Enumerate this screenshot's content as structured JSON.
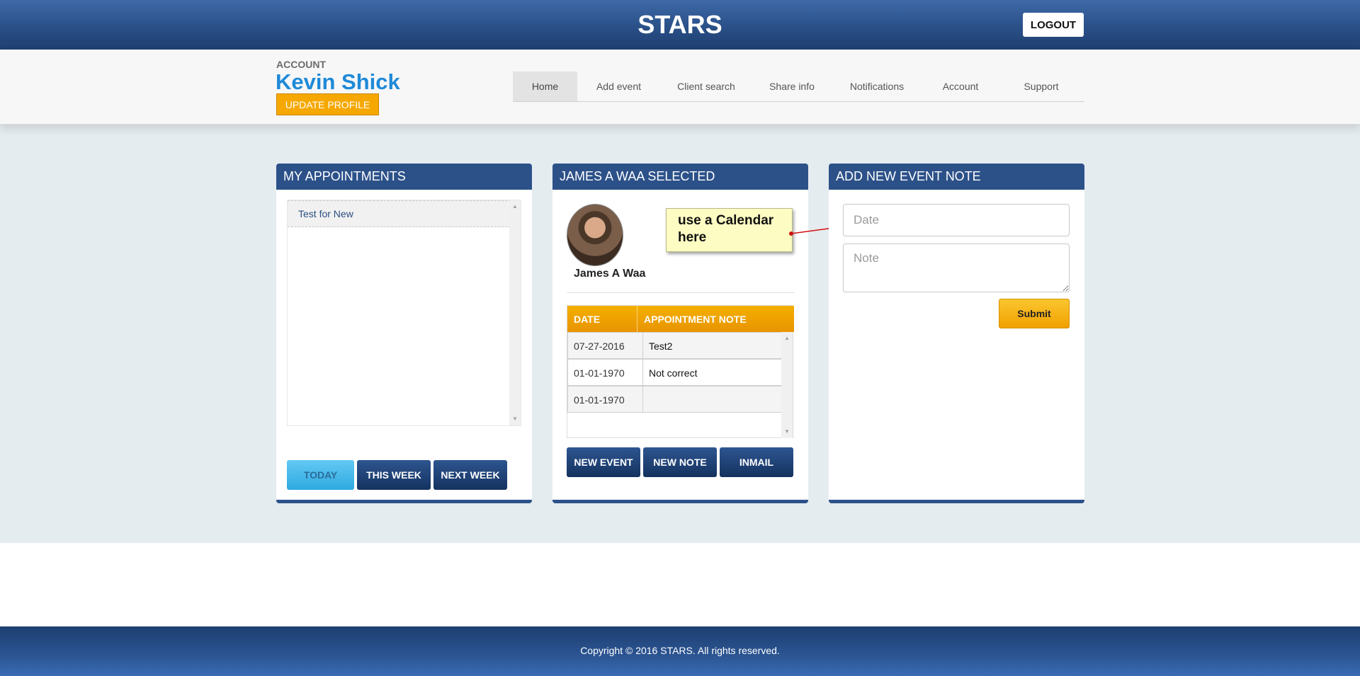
{
  "header": {
    "title": "STARS",
    "logout_label": "LOGOUT"
  },
  "account": {
    "label": "ACCOUNT",
    "name": "Kevin Shick",
    "update_label": "UPDATE PROFILE"
  },
  "nav": {
    "items": [
      {
        "label": "Home",
        "active": true
      },
      {
        "label": "Add event"
      },
      {
        "label": "Client search"
      },
      {
        "label": "Share info"
      },
      {
        "label": "Notifications"
      },
      {
        "label": "Account"
      },
      {
        "label": "Support"
      }
    ]
  },
  "appointments": {
    "title": "MY APPOINTMENTS",
    "items": [
      "Test for New"
    ],
    "buttons": {
      "today": "TODAY",
      "this_week": "THIS WEEK",
      "next_week": "NEXT WEEK"
    }
  },
  "selected": {
    "title": "JAMES A WAA SELECTED",
    "client_name": "James A Waa",
    "callout": "use a Calendar here",
    "table": {
      "headers": {
        "date": "DATE",
        "note": "APPOINTMENT NOTE"
      },
      "rows": [
        {
          "date": "07-27-2016",
          "note": "Test2"
        },
        {
          "date": "01-01-1970",
          "note": "Not correct"
        },
        {
          "date": "01-01-1970",
          "note": ""
        }
      ]
    },
    "buttons": {
      "new_event": "NEW EVENT",
      "new_note": "NEW NOTE",
      "inmail": "INMAIL"
    }
  },
  "event_note": {
    "title": "ADD NEW EVENT NOTE",
    "date_placeholder": "Date",
    "note_placeholder": "Note",
    "submit_label": "Submit"
  },
  "footer": {
    "copyright": "Copyright © 2016 STARS. All rights reserved."
  },
  "colors": {
    "primary": "#2c5189",
    "accent": "#f6a800",
    "link": "#1e8ad8",
    "bg": "#e5ecf0"
  }
}
